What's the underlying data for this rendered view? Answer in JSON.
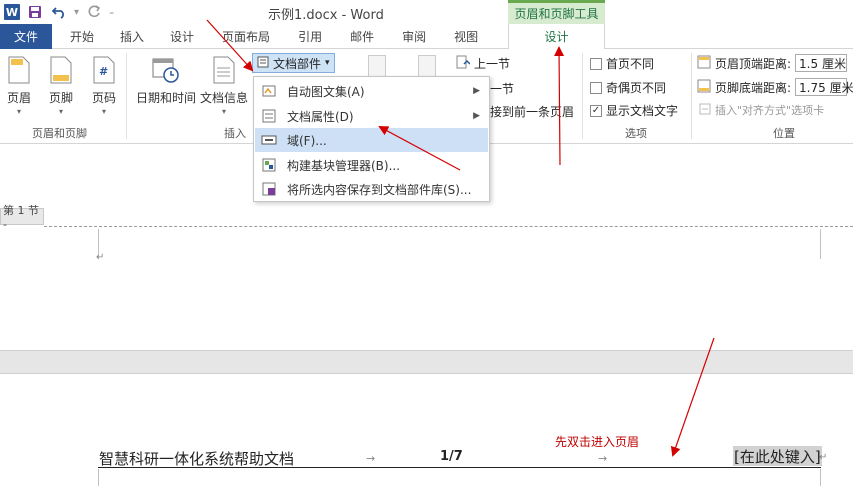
{
  "app": {
    "title": "示例1.docx - Word",
    "contextual_tab_group": "页眉和页脚工具",
    "logo_letter": "W"
  },
  "tabs": [
    {
      "label": "文件"
    },
    {
      "label": "开始"
    },
    {
      "label": "插入"
    },
    {
      "label": "设计"
    },
    {
      "label": "页面布局"
    },
    {
      "label": "引用"
    },
    {
      "label": "邮件"
    },
    {
      "label": "审阅"
    },
    {
      "label": "视图"
    },
    {
      "label": "设计"
    }
  ],
  "ribbon": {
    "hf_group": {
      "label": "页眉和页脚",
      "header": "页眉",
      "footer": "页脚",
      "page_number": "页码"
    },
    "insert_group": {
      "label": "插入",
      "datetime": "日期和时间",
      "docinfo": "文档信息",
      "docparts": "文档部件",
      "docparts_caret": "▾"
    },
    "nav_group": {
      "prev": "上一节",
      "next": "一节",
      "link": "接到前一条页眉"
    },
    "options_group": {
      "label": "选项",
      "different_first": "首页不同",
      "different_odd_even": "奇偶页不同",
      "show_text": "显示文档文字",
      "show_text_checked": true
    },
    "position_group": {
      "label": "位置",
      "header_top_label": "页眉顶端距离:",
      "header_top_value": "1.5 厘米",
      "footer_bottom_label": "页脚底端距离:",
      "footer_bottom_value": "1.75 厘米",
      "insert_align_tab": "插入\"对齐方式\"选项卡"
    }
  },
  "menu": {
    "items": [
      {
        "label": "自动图文集(A)",
        "has_submenu": true
      },
      {
        "label": "文档属性(D)",
        "has_submenu": true
      },
      {
        "label": "域(F)...",
        "has_submenu": false,
        "highlighted": true
      },
      {
        "label": "构建基块管理器(B)...",
        "has_submenu": false
      },
      {
        "label": "将所选内容保存到文档部件库(S)...",
        "has_submenu": false
      }
    ]
  },
  "document": {
    "section_tag": "第 1 节 -",
    "header_text": "智慧科研一体化系统帮助文档",
    "page_number": "1/7",
    "placeholder": "[在此处键入]",
    "note": "先双击进入页眉",
    "para_mark": "↵",
    "tab_mark": "→"
  },
  "colors": {
    "accent": "#2b579a",
    "contextual": "#217346",
    "contextual_bg": "#d7ebce",
    "highlight": "#cde0f5",
    "annotation": "#c00000"
  },
  "icons": {
    "save": "save-icon",
    "undo": "undo-icon",
    "redo": "redo-icon"
  }
}
